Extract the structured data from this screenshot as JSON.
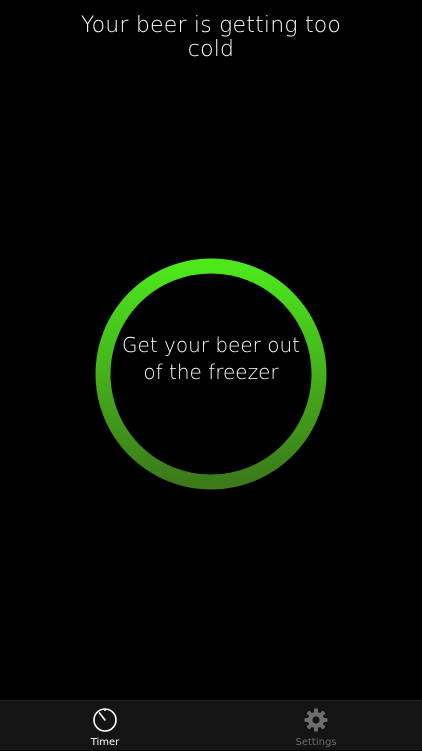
{
  "header": {
    "title": "Your beer is getting too cold"
  },
  "status_ring": {
    "message": "Get your beer out of the freezer",
    "colors": {
      "top": "#4ce81c",
      "bottom": "#3c7a1a"
    }
  },
  "tab_bar": {
    "tabs": [
      {
        "label": "Timer",
        "icon": "timer-icon",
        "selected": true
      },
      {
        "label": "Settings",
        "icon": "gear-icon",
        "selected": false
      }
    ],
    "colors": {
      "active": "#ffffff",
      "inactive": "#6e6e6e",
      "background": "#141414"
    }
  }
}
